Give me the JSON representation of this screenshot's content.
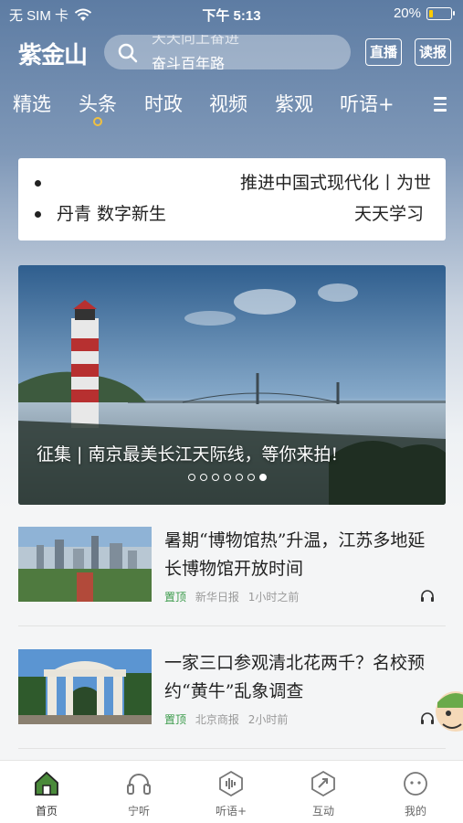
{
  "status": {
    "carrier": "无 SIM 卡",
    "time": "下午 5:13",
    "battery": "20%",
    "battery_level": 0.2
  },
  "header": {
    "logo": "紫金山",
    "search_line1": "天天向上奋进",
    "search_line2": "奋斗百年路",
    "live_label": "直播",
    "paper_label": "读报"
  },
  "tabs": [
    "精选",
    "头条",
    "时政",
    "视频",
    "紫观",
    "听语+"
  ],
  "active_tab": "头条",
  "ticker": [
    {
      "left": "",
      "right": "推进中国式现代化丨为世"
    },
    {
      "left": "丹青  数字新生",
      "right": "天天学习"
    }
  ],
  "banner": {
    "caption": "征集  |  南京最美长江天际线，等你来拍!",
    "dot_count": 7,
    "active_dot": 6
  },
  "news": [
    {
      "title": "暑期“博物馆热”升温，江苏多地延长博物馆开放时间",
      "pin": "置顶",
      "source": "新华日报",
      "time": "1小时之前"
    },
    {
      "title": "一家三口参观清北花两千？名校预约“黄牛”乱象调查",
      "pin": "置顶",
      "source": "北京商报",
      "time": "2小时前"
    }
  ],
  "tabbar": [
    {
      "label": "首页",
      "icon": "home-icon"
    },
    {
      "label": "宁听",
      "icon": "headphones-icon"
    },
    {
      "label": "听语+",
      "icon": "sound-wave-icon"
    },
    {
      "label": "互动",
      "icon": "interact-icon"
    },
    {
      "label": "我的",
      "icon": "face-icon"
    }
  ],
  "colors": {
    "header_bg": "#6a86aa",
    "pin_green": "#3a9a4a",
    "tab_indicator": "#f0c040"
  }
}
